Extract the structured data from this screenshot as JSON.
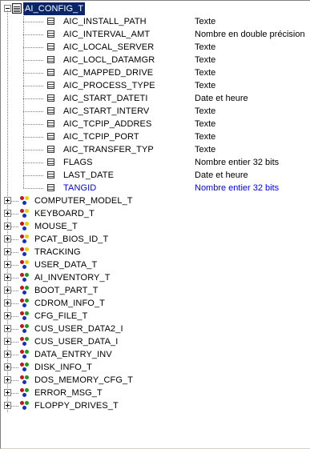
{
  "root": {
    "label": "AI_CONFIG_T"
  },
  "columns": [
    {
      "name": "AIC_INSTALL_PATH",
      "type": "Texte"
    },
    {
      "name": "AIC_INTERVAL_AMT",
      "type": "Nombre en double précision"
    },
    {
      "name": "AIC_LOCAL_SERVER",
      "type": "Texte"
    },
    {
      "name": "AIC_LOCL_DATAMGR",
      "type": "Texte"
    },
    {
      "name": "AIC_MAPPED_DRIVE",
      "type": "Texte"
    },
    {
      "name": "AIC_PROCESS_TYPE",
      "type": "Texte"
    },
    {
      "name": "AIC_START_DATETI",
      "type": "Date et heure"
    },
    {
      "name": "AIC_START_INTERV",
      "type": "Texte"
    },
    {
      "name": "AIC_TCPIP_ADDRES",
      "type": "Texte"
    },
    {
      "name": "AIC_TCPIP_PORT",
      "type": "Texte"
    },
    {
      "name": "AIC_TRANSFER_TYP",
      "type": "Texte"
    },
    {
      "name": "FLAGS",
      "type": "Nombre entier 32 bits"
    },
    {
      "name": "LAST_DATE",
      "type": "Date et heure"
    },
    {
      "name": "TANGID",
      "type": "Nombre entier 32 bits",
      "highlight": true
    }
  ],
  "relations": [
    {
      "label": "COMPUTER_MODEL_T",
      "icon": "relation-icon-yellow"
    },
    {
      "label": "KEYBOARD_T",
      "icon": "relation-icon-yellow"
    },
    {
      "label": "MOUSE_T",
      "icon": "relation-icon-yellow"
    },
    {
      "label": "PCAT_BIOS_ID_T",
      "icon": "relation-icon-yellow"
    },
    {
      "label": "TRACKING",
      "icon": "relation-icon-yellow"
    },
    {
      "label": "USER_DATA_T",
      "icon": "relation-icon-yellow"
    },
    {
      "label": "AI_INVENTORY_T",
      "icon": "relation-icon-green"
    },
    {
      "label": "BOOT_PART_T",
      "icon": "relation-icon-green"
    },
    {
      "label": "CDROM_INFO_T",
      "icon": "relation-icon-green"
    },
    {
      "label": "CFG_FILE_T",
      "icon": "relation-icon-green"
    },
    {
      "label": "CUS_USER_DATA2_I",
      "icon": "relation-icon-green"
    },
    {
      "label": "CUS_USER_DATA_I",
      "icon": "relation-icon-green"
    },
    {
      "label": "DATA_ENTRY_INV",
      "icon": "relation-icon-green"
    },
    {
      "label": "DISK_INFO_T",
      "icon": "relation-icon-green"
    },
    {
      "label": "DOS_MEMORY_CFG_T",
      "icon": "relation-icon-green"
    },
    {
      "label": "ERROR_MSG_T",
      "icon": "relation-icon-green"
    },
    {
      "label": "FLOPPY_DRIVES_T",
      "icon": "relation-icon-green"
    }
  ],
  "colors": {
    "selection": "#0a246a",
    "highlight_text": "#0000ff",
    "relation_yellow": "#e8d000",
    "relation_green": "#1a9a1a",
    "relation_red": "#d01010",
    "relation_blue": "#1030c0"
  }
}
